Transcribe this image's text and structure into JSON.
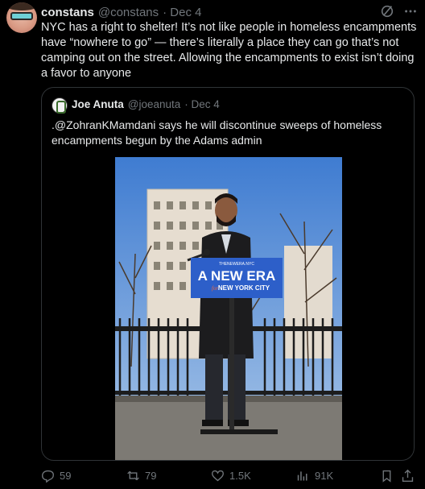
{
  "tweet": {
    "author_name": "constans",
    "author_handle": "@constans",
    "date": "· Dec 4",
    "text": "NYC has a right to shelter! It’s not like people in homeless encampments have “nowhere to go” — there’s literally a place they can go that’s not camping out on the street. Allowing the encampments to exist isn’t doing a favor to anyone"
  },
  "quote": {
    "author_name": "Joe Anuta",
    "author_handle": "@joeanuta",
    "date": "· Dec 4",
    "text": ".@ZohranKMamdani says he will discontinue sweeps of homeless encampments begun by the Adams admin",
    "sign_top": "THENEWERA.NYC",
    "sign_main": "A NEW ERA",
    "sign_for": "for",
    "sign_city": "NEW YORK CITY"
  },
  "actions": {
    "replies": "59",
    "reposts": "79",
    "likes": "1.5K",
    "views": "91K"
  },
  "icons": [
    "grok-icon",
    "more-icon",
    "reply-icon",
    "repost-icon",
    "like-icon",
    "views-icon",
    "bookmark-icon",
    "share-icon"
  ],
  "colors": {
    "background": "#000000",
    "muted": "#71767b",
    "text": "#e7e9ea",
    "sign_blue": "#2d5fc9"
  }
}
